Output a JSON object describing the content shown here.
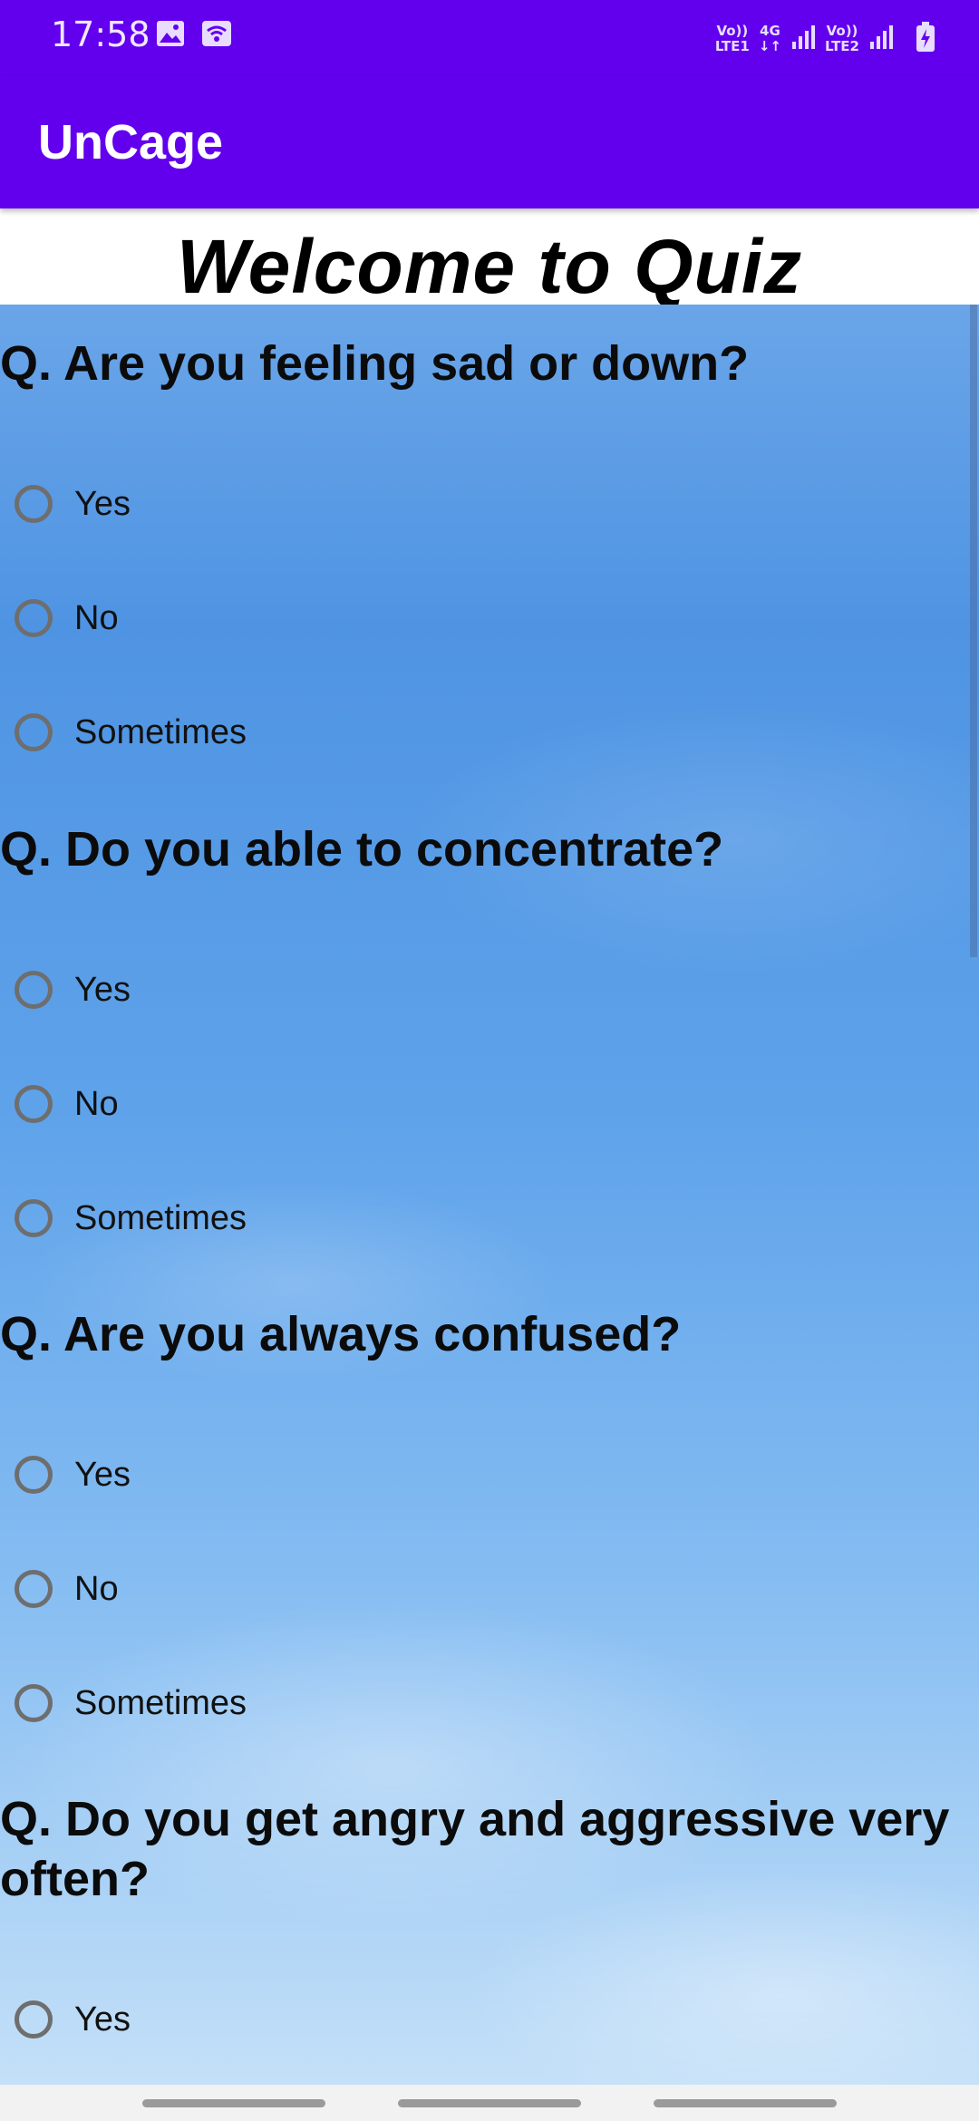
{
  "status_bar": {
    "time": "17:58",
    "icons": [
      "image-icon",
      "wifi-calling-icon",
      "signal-icon",
      "battery-charging-icon"
    ],
    "net1_top": "Vo))",
    "net1_bottom": "LTE1",
    "net_type": "4G",
    "net2_top": "Vo))",
    "net2_bottom": "LTE2"
  },
  "app_bar": {
    "title": "UnCage"
  },
  "header": {
    "welcome": "Welcome to Quiz"
  },
  "quiz": {
    "questions": [
      {
        "text": "Q. Are you feeling sad or down?",
        "options": [
          "Yes",
          "No",
          "Sometimes"
        ]
      },
      {
        "text": "Q. Do you able to concentrate?",
        "options": [
          "Yes",
          "No",
          "Sometimes"
        ]
      },
      {
        "text": "Q. Are you always confused?",
        "options": [
          "Yes",
          "No",
          "Sometimes"
        ]
      },
      {
        "text": "Q. Do you get angry and aggressive very often?",
        "options": [
          "Yes"
        ]
      }
    ]
  },
  "colors": {
    "primary": "#6200ee",
    "radio_border": "#6e6e6e",
    "sky_top": "#4f94e3",
    "sky_bottom": "#c4e0f8"
  }
}
